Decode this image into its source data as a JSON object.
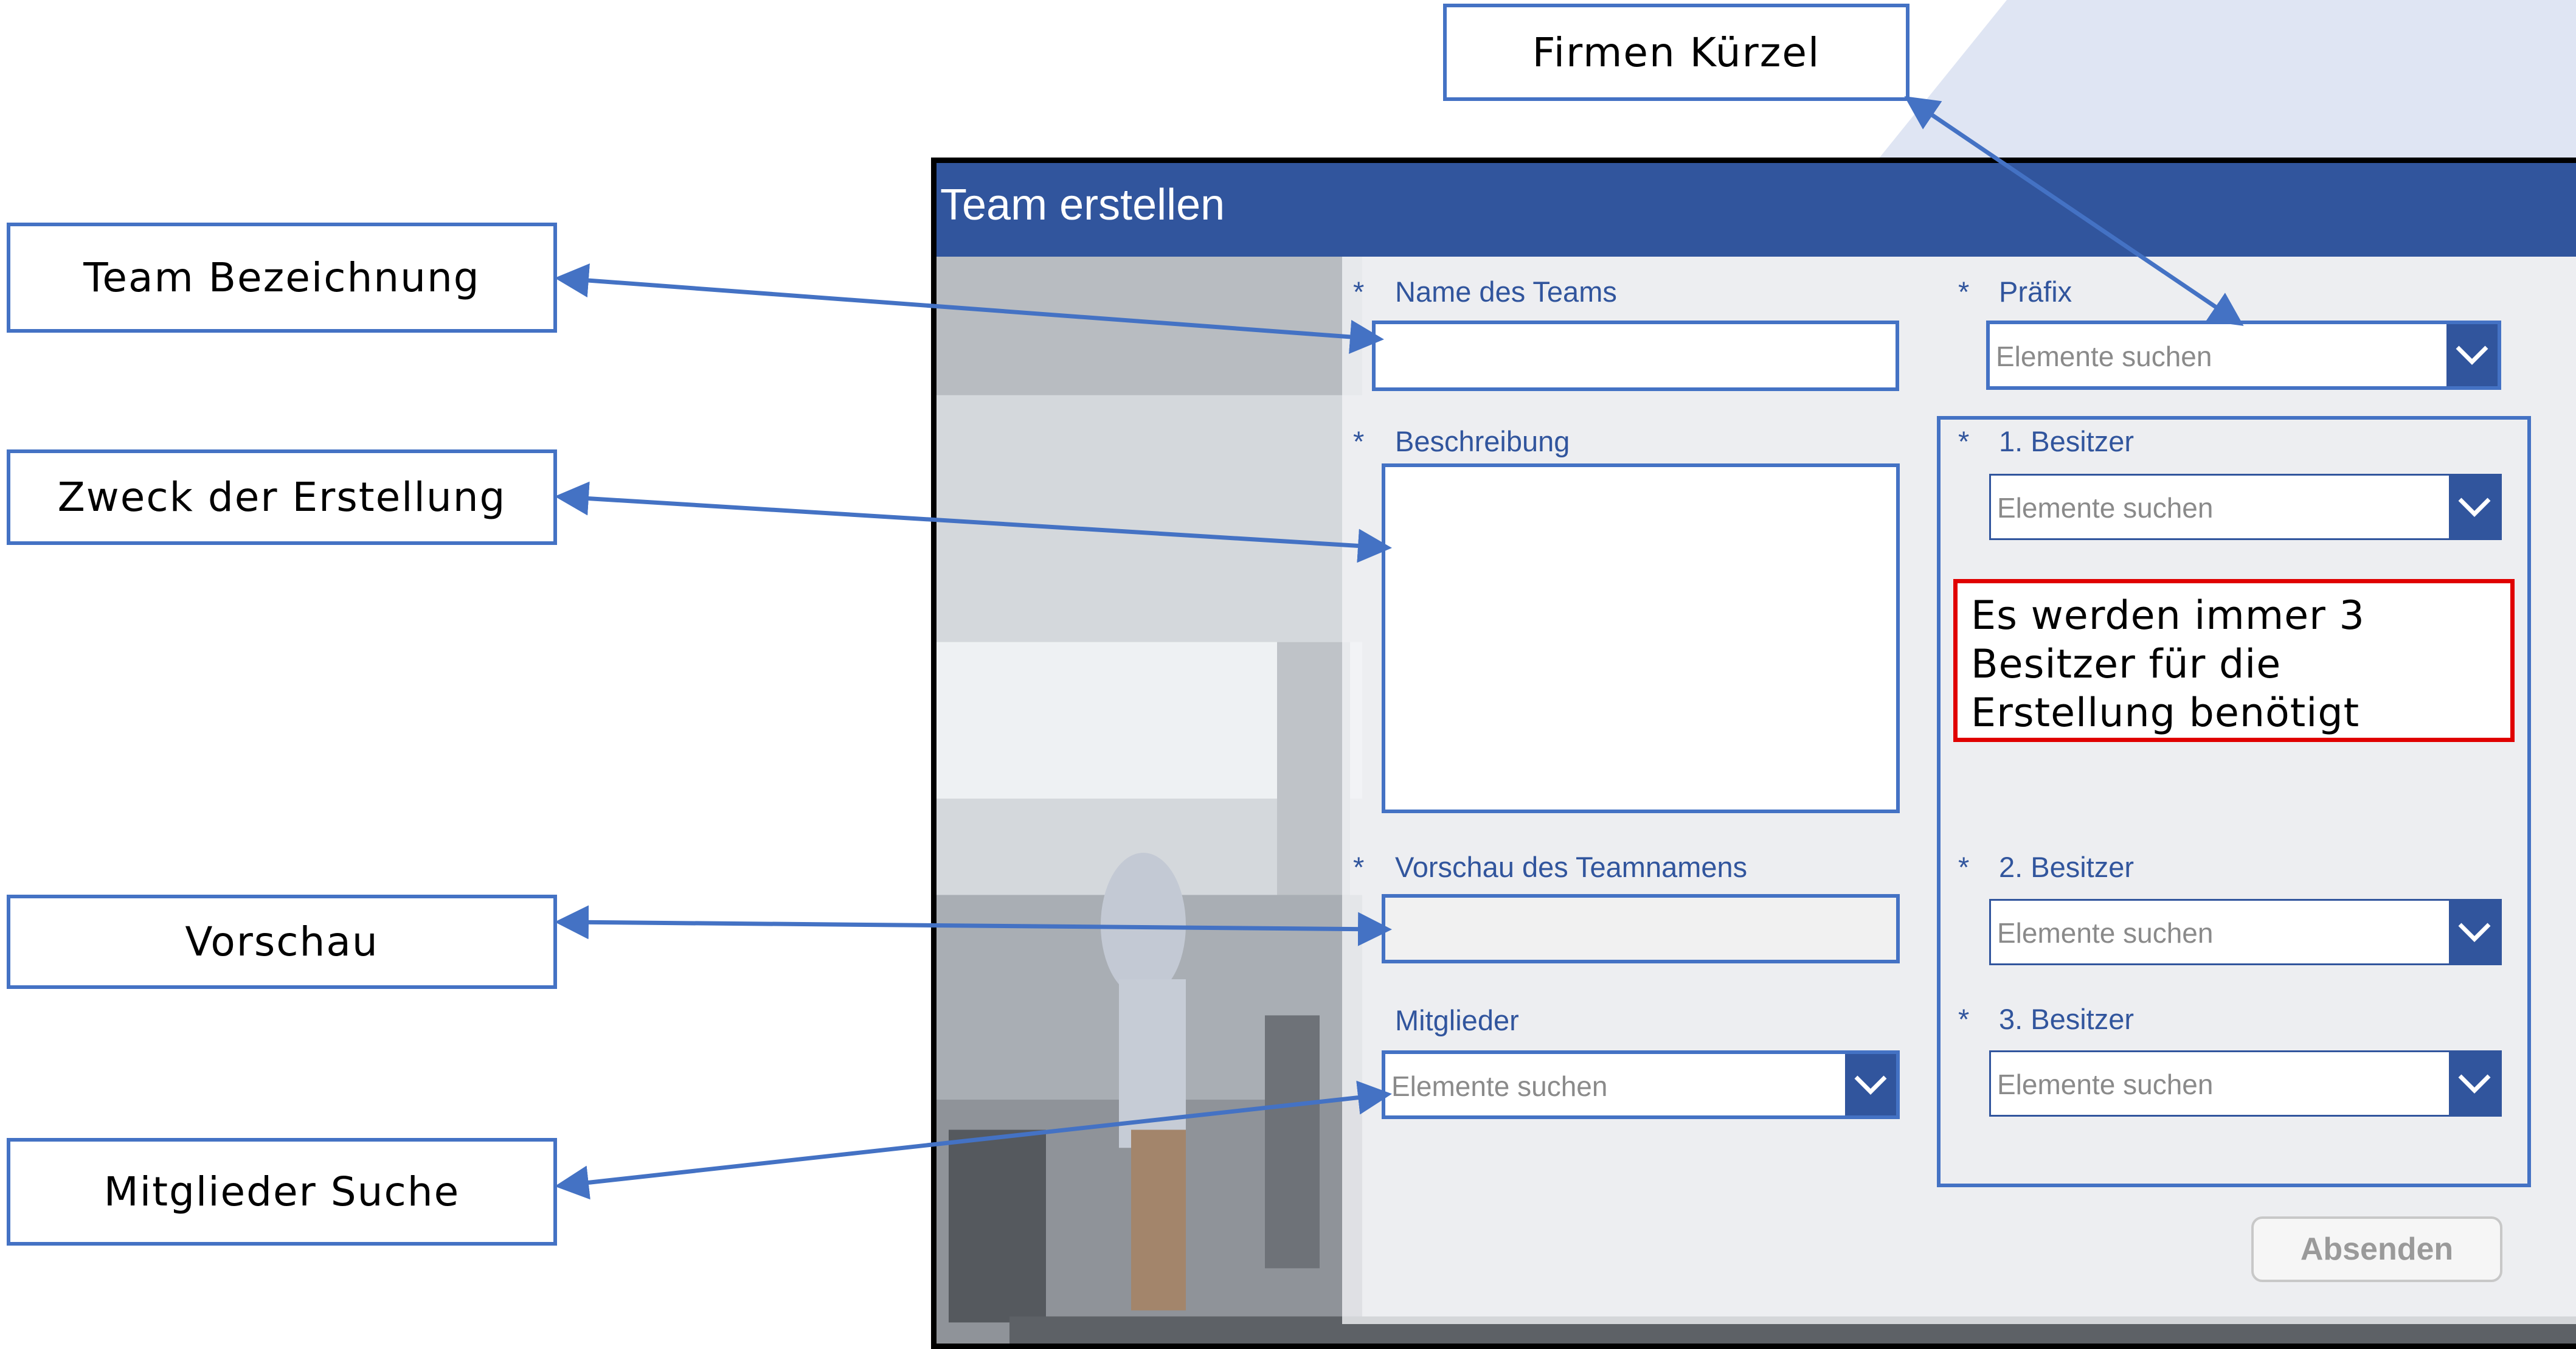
{
  "window": {
    "title": "Team erstellen"
  },
  "callouts": {
    "team": "Team Bezeichnung",
    "zweck": "Zweck der Erstellung",
    "vorschau": "Vorschau",
    "mitglieder": "Mitglieder Suche",
    "firmen": "Firmen Kürzel"
  },
  "form": {
    "required_marker": "*",
    "team_name": {
      "label": "Name des Teams",
      "value": ""
    },
    "description": {
      "label": "Beschreibung",
      "value": ""
    },
    "preview": {
      "label": "Vorschau des Teamnamens",
      "value": ""
    },
    "members": {
      "label": "Mitglieder",
      "placeholder": "Elemente suchen"
    },
    "prefix": {
      "label": "Präfix",
      "placeholder": "Elemente suchen"
    },
    "owner1": {
      "label": "1. Besitzer",
      "placeholder": "Elemente suchen"
    },
    "owner2": {
      "label": "2. Besitzer",
      "placeholder": "Elemente suchen"
    },
    "owner3": {
      "label": "3. Besitzer",
      "placeholder": "Elemente suchen"
    },
    "note": "Es werden immer 3 Besitzer für die Erstellung benötigt",
    "submit_label": "Absenden"
  },
  "colors": {
    "title_bar": "#31559d",
    "annotation_blue": "#4472c4",
    "note_border": "#e00000",
    "label_text": "#31559d"
  },
  "icons": {
    "combo_button": "chevron-down-icon"
  }
}
